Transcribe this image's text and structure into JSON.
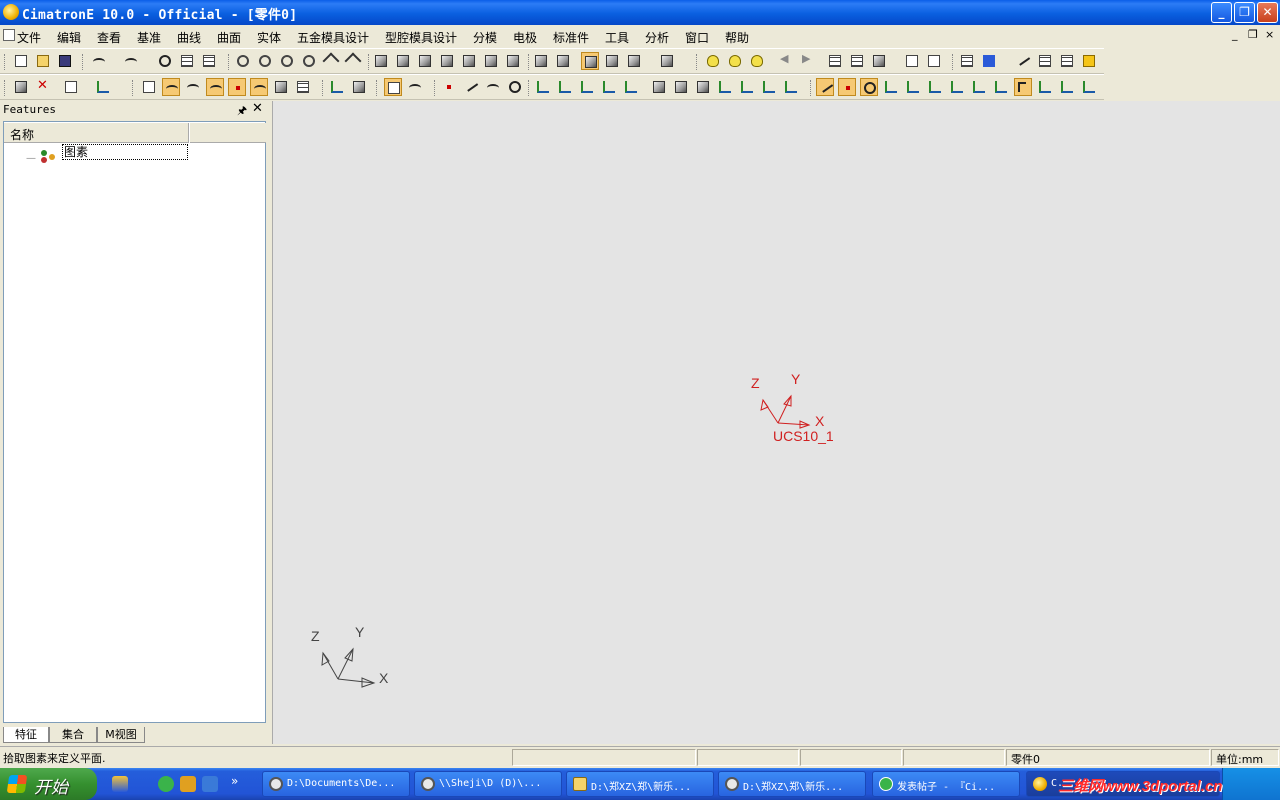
{
  "window": {
    "title": "CimatronE 10.0 - Official - [零件0]"
  },
  "menu": {
    "items": [
      "文件",
      "编辑",
      "查看",
      "基准",
      "曲线",
      "曲面",
      "实体",
      "五金模具设计",
      "型腔模具设计",
      "分模",
      "电极",
      "标准件",
      "工具",
      "分析",
      "窗口",
      "帮助"
    ],
    "mdi_controls": [
      "_",
      "❐",
      "×"
    ]
  },
  "features_panel": {
    "title": "Features",
    "column_header": "名称",
    "tree": [
      {
        "label": "图素"
      }
    ],
    "tabs": [
      "特征",
      "集合",
      "M视图"
    ]
  },
  "viewport": {
    "ucs_center": {
      "labels": {
        "z": "Z",
        "y": "Y",
        "x": "X"
      },
      "name": "UCS10_1",
      "color": "#d02020"
    },
    "ucs_corner": {
      "labels": {
        "z": "Z",
        "y": "Y",
        "x": "X"
      },
      "color": "#444444"
    }
  },
  "statusbar": {
    "message": "拾取图素来定义平面.",
    "part": "零件0",
    "units": "单位:mm"
  },
  "taskbar": {
    "start_label": "开始",
    "tasks": [
      {
        "label": "D:\\Documents\\De...",
        "icon": "cimatron-app-icon"
      },
      {
        "label": "\\\\Sheji\\D (D)\\...",
        "icon": "cimatron-app-icon"
      },
      {
        "label": "D:\\郑XZ\\郑\\新乐...",
        "icon": "folder-icon"
      },
      {
        "label": "D:\\郑XZ\\郑\\新乐...",
        "icon": "cimatron-app-icon"
      },
      {
        "label": "发表帖子 - 『Ci...",
        "icon": "ie-icon"
      },
      {
        "label": "C...",
        "icon": "cimatron-app-icon"
      }
    ],
    "watermark": "三维网www.3dportal.cn"
  }
}
